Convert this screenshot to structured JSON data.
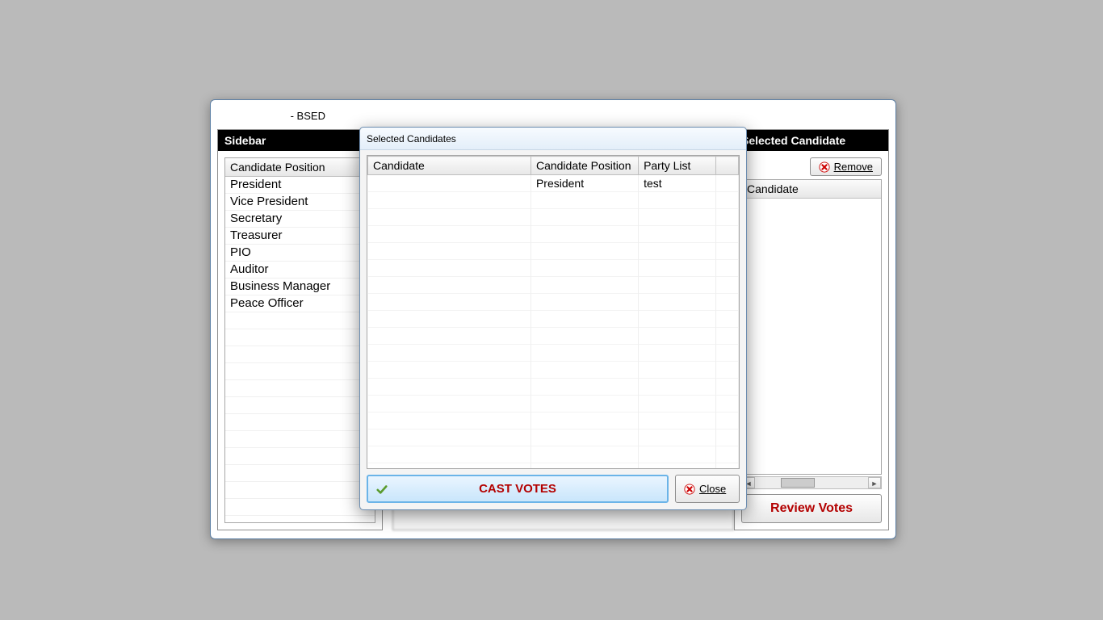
{
  "main": {
    "title_suffix": " - BSED"
  },
  "sidebar": {
    "header": "Sidebar",
    "column": "Candidate Position",
    "items": [
      "President",
      "Vice President",
      "Secretary",
      "Treasurer",
      "PIO",
      "Auditor",
      "Business Manager",
      "Peace Officer"
    ]
  },
  "middle": {
    "red_name_placeholder": ""
  },
  "right": {
    "header": "Selected Candidate",
    "remove_label": "Remove",
    "column": "Candidate",
    "review_label": "Review Votes"
  },
  "modal": {
    "title": "Selected Candidates",
    "columns": [
      "Candidate",
      "Candidate Position",
      "Party List"
    ],
    "rows": [
      {
        "candidate": "",
        "position": "President",
        "party": "test"
      }
    ],
    "cast_label": "CAST VOTES",
    "close_label": "Close"
  }
}
